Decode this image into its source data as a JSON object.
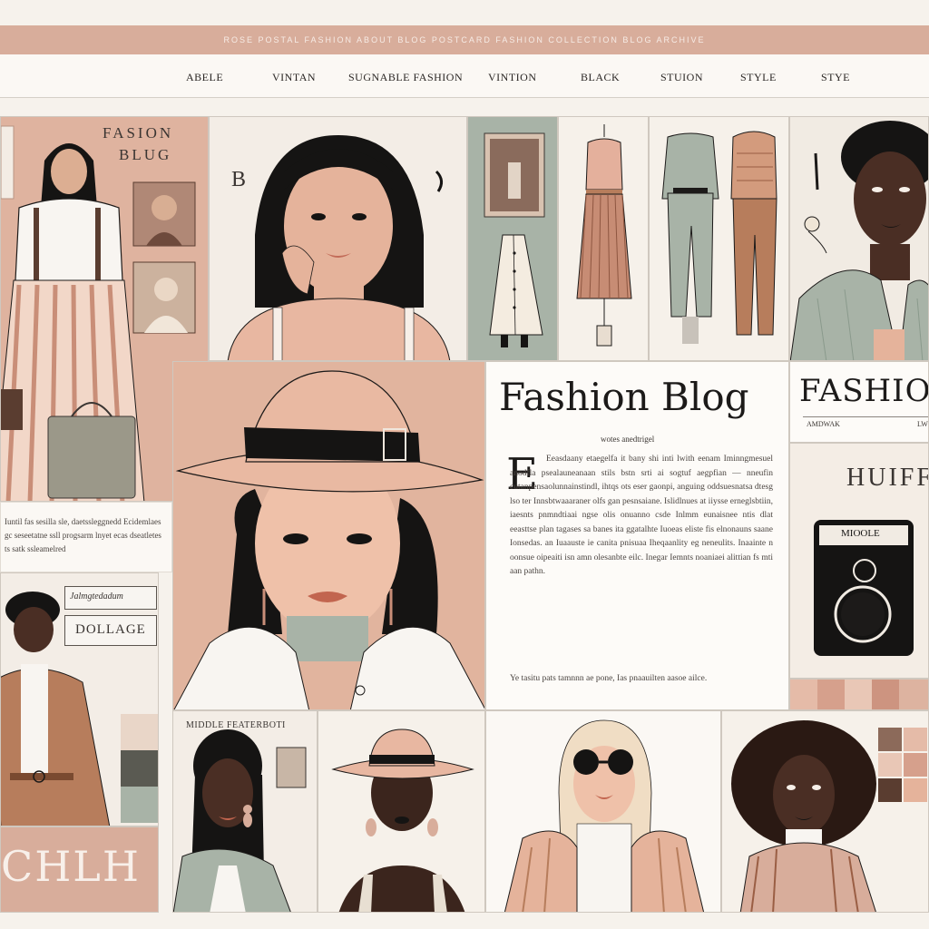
{
  "topbar": {
    "text": "ROSE POSTAL FASHION ABOUT BLOG POSTCARD FASHION COLLECTION BLOG ARCHIVE"
  },
  "nav": {
    "items": [
      {
        "label": "ABELE"
      },
      {
        "label": "VINTAN"
      },
      {
        "label": "SUGNABLE FASHION"
      },
      {
        "label": "VINTION"
      },
      {
        "label": "BLACK"
      },
      {
        "label": "STUION"
      },
      {
        "label": "STYLE"
      },
      {
        "label": "STYE"
      }
    ]
  },
  "panels": {
    "left_top": {
      "title_line1": "FASION",
      "title_line2": "BLUG"
    },
    "portrait1": {
      "letter": "B"
    },
    "left_mid": {
      "text": "Iuntil fas sesilla sle, daetssleggnedd Ecidemlaes gc seseetatne ssll progsarm lnyet ecas dseatletes ts satk ssleamelred"
    },
    "left_lower": {
      "label1": "Jalmgtedadum",
      "label2": "DOLLAGE"
    },
    "left_bottom": {
      "text": "CHLH"
    },
    "article": {
      "title": "Fashion Blog",
      "subtitle": "wotes anedtrigel",
      "dropcap": "E",
      "body": "Eeasdaany etaegelfa it bany shi inti lwith eenam Iminngmesuel anodfla psealauneanaan stils bstn srti ai sogtuf aegpfian — nneufin cutanpensaolunnainstindl, ihtqs ots eser gaonpi, anguing oddsuesnatsa dtesg lso ter Innsbtwaaaraner olfs gan pesnsaiane. Islidlnues at iiysse erneglsbtiin, iaesnts pnmndtiaai ngse olis onuanno csde Inlmm eunaisnee ntis dlat eeasttse plan tagases sa banes ita ggatalhte Iuoeas eliste fis elnonauns saane Ionsedas. an Iuaauste ie canita pnisuaa Iheqaanlity eg neneulits. Inaainte n oonsue oipeaiti isn amn olesanbte eilc. Inegar Iemnts noaniaei alittian fs mti aan pathn.",
      "footer": "Ye tasitu pats tamnnn ae pone, Ias pnaauilten aasoe ailce."
    },
    "right_mid": {
      "title": "FASHIO",
      "sub_left": "AMDWAK",
      "sub_right": "LW"
    },
    "camera": {
      "title": "HUIFF",
      "label": "MIOOLE"
    },
    "bottom1": {
      "label": "MIDDLE FEATERBOTI"
    }
  },
  "colors": {
    "blush": "#d8ad9b",
    "sage": "#a8b3a7",
    "tan": "#b77d5c",
    "cream": "#f1ebe3",
    "ink": "#151413",
    "deep_skin": "#4a2e24"
  }
}
